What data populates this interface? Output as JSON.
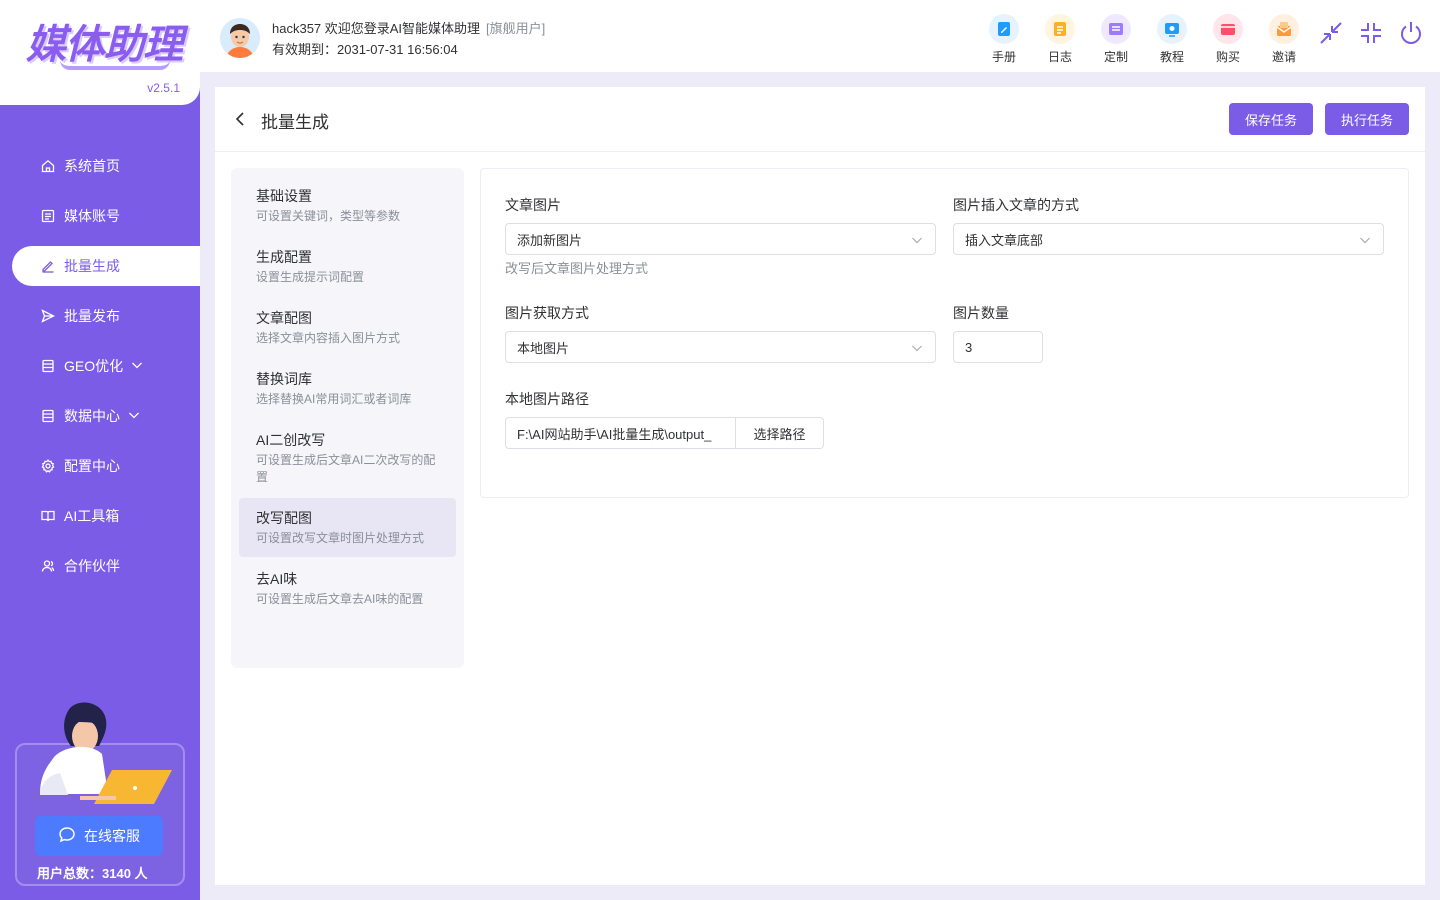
{
  "app": {
    "logo_text": "媒体助理",
    "version": "v2.5.1"
  },
  "sidebar": {
    "items": [
      {
        "label": "系统首页",
        "icon": "home-icon"
      },
      {
        "label": "媒体账号",
        "icon": "account-icon"
      },
      {
        "label": "批量生成",
        "icon": "edit-icon",
        "active": true
      },
      {
        "label": "批量发布",
        "icon": "send-icon"
      },
      {
        "label": "GEO优化",
        "icon": "document-icon",
        "expandable": true
      },
      {
        "label": "数据中心",
        "icon": "document-icon",
        "expandable": true
      },
      {
        "label": "配置中心",
        "icon": "gear-icon"
      },
      {
        "label": "AI工具箱",
        "icon": "book-icon"
      },
      {
        "label": "合作伙伴",
        "icon": "people-icon"
      }
    ],
    "support_label": "在线客服",
    "user_count_label": "用户总数：3140 人"
  },
  "header": {
    "welcome": "hack357 欢迎您登录AI智能媒体助理",
    "user_tag": "[旗舰用户]",
    "expire": "有效期到：2031-07-31 16:56:04",
    "tools": [
      {
        "label": "手册",
        "icon": "manual-icon",
        "color": "#1e9bff",
        "bg": "#e6f3ff"
      },
      {
        "label": "日志",
        "icon": "log-icon",
        "color": "#ffb020",
        "bg": "#fff5e0"
      },
      {
        "label": "定制",
        "icon": "custom-icon",
        "color": "#9b7bff",
        "bg": "#efe9ff"
      },
      {
        "label": "教程",
        "icon": "tutorial-icon",
        "color": "#1e9bff",
        "bg": "#e6f3ff"
      },
      {
        "label": "购买",
        "icon": "purchase-icon",
        "color": "#ff4d6a",
        "bg": "#ffe6ea"
      },
      {
        "label": "邀请",
        "icon": "invite-icon",
        "color": "#ff9a3c",
        "bg": "#fff0e0"
      }
    ]
  },
  "page": {
    "title": "批量生成",
    "save_label": "保存任务",
    "run_label": "执行任务"
  },
  "steps": [
    {
      "title": "基础设置",
      "desc": "可设置关键词，类型等参数"
    },
    {
      "title": "生成配置",
      "desc": "设置生成提示词配置"
    },
    {
      "title": "文章配图",
      "desc": "选择文章内容插入图片方式"
    },
    {
      "title": "替换词库",
      "desc": "选择替换AI常用词汇或者词库"
    },
    {
      "title": "AI二创改写",
      "desc": "可设置生成后文章AI二次改写的配置"
    },
    {
      "title": "改写配图",
      "desc": "可设置改写文章时图片处理方式",
      "active": true
    },
    {
      "title": "去AI味",
      "desc": "可设置生成后文章去AI味的配置"
    }
  ],
  "form": {
    "article_image_label": "文章图片",
    "article_image_value": "添加新图片",
    "article_image_hint": "改写后文章图片处理方式",
    "insert_mode_label": "图片插入文章的方式",
    "insert_mode_value": "插入文章底部",
    "source_label": "图片获取方式",
    "source_value": "本地图片",
    "count_label": "图片数量",
    "count_value": "3",
    "path_label": "本地图片路径",
    "path_value": "F:\\AI网站助手\\AI批量生成\\output_",
    "path_button": "选择路径"
  },
  "colors": {
    "brand": "#7b5ce6",
    "support_button": "#4c7bff"
  }
}
